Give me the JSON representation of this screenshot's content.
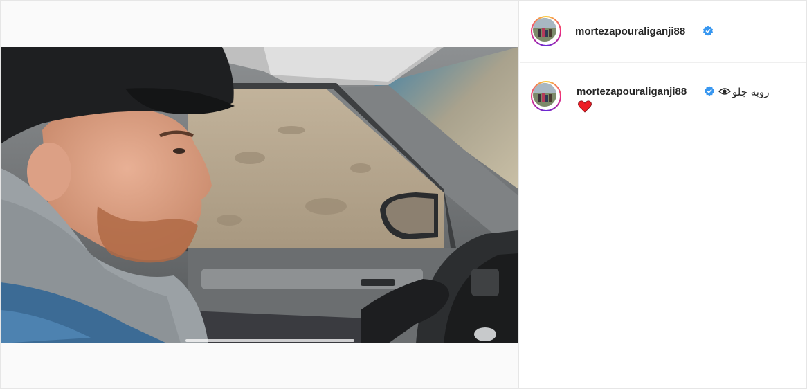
{
  "post": {
    "username": "mortezapouraliganji88",
    "verified": true,
    "icon_verified": "verified-badge-icon",
    "avatar_alt": "profile picture"
  },
  "comment": {
    "username": "mortezapouraliganji88",
    "text": "روبه جلو",
    "icon_eye": "eye-icon",
    "icon_heart": "red-heart-icon"
  },
  "colors": {
    "verified": "#3897f0",
    "text": "#262626",
    "heart": "#ed1c24"
  },
  "carousel": {
    "dots_visible": false
  }
}
